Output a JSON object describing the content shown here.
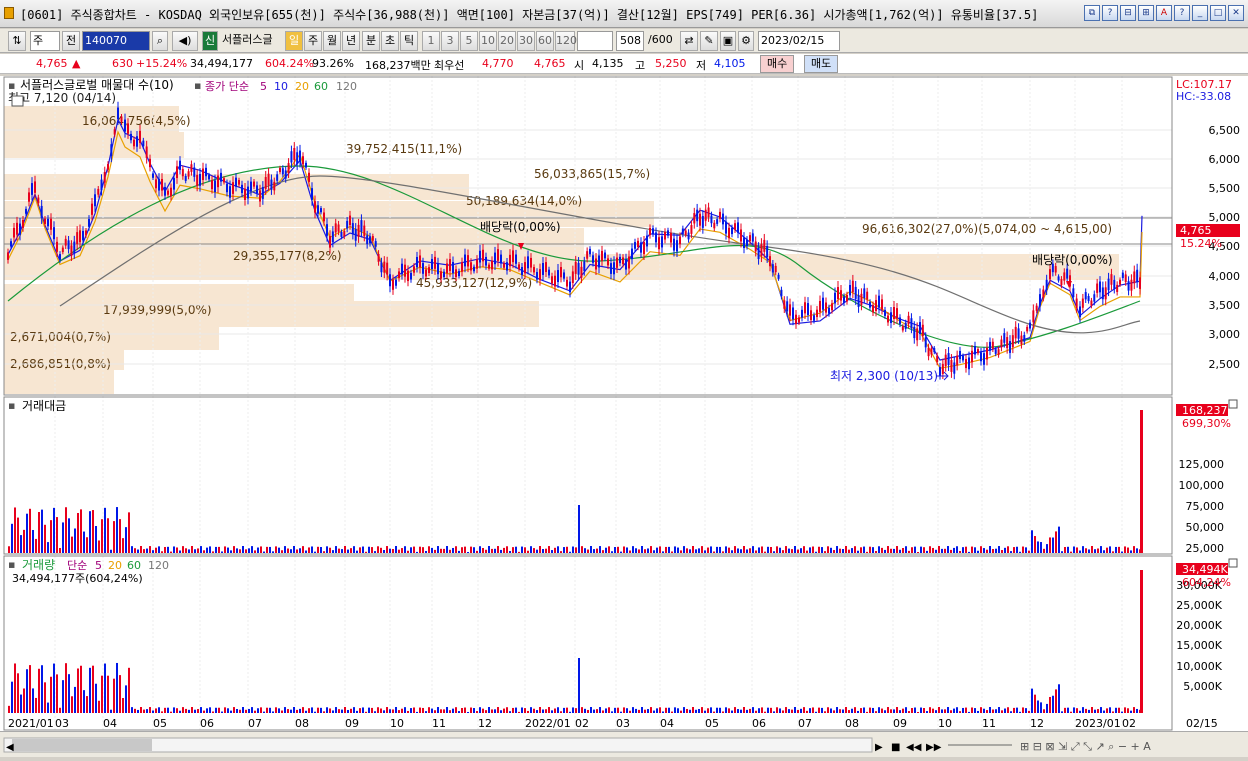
{
  "window": {
    "title": "[0601] 주식종합차트 - KOSDAQ 외국인보유[655(천)] 주식수[36,988(천)] 액면[100] 자본금[37(억)] 결산[12월] EPS[749] PER[6.36] 시가총액[1,762(억)] 유통비율[37.5]",
    "buttons": [
      "⧉",
      "?",
      "⊟",
      "⊞",
      "A",
      "?",
      "_",
      "□",
      "✕"
    ]
  },
  "toolbar": {
    "market": "주",
    "prev_label": "전",
    "code": "140070",
    "stock_name": "서플러스글",
    "tabs": [
      "일",
      "주",
      "월",
      "년",
      "분",
      "초",
      "틱"
    ],
    "numbers": [
      "1",
      "3",
      "5",
      "10",
      "20",
      "30",
      "60",
      "120"
    ],
    "count": "508",
    "total": "/600",
    "date": "2023/02/15"
  },
  "quote": {
    "price": "4,765",
    "arrow": "▲",
    "change": "630",
    "change_pct": "+15.24%",
    "volume": "34,494,177",
    "volume_pct": "604.24%",
    "vol_ratio": "93.26%",
    "amount": "168,237백만",
    "best_label": "최우선",
    "best_ask": "4,770",
    "best_bid": "4,765",
    "open_label": "시",
    "open": "4,135",
    "high_label": "고",
    "high": "5,250",
    "low_label": "저",
    "low": "4,105",
    "buy": "매수",
    "sell": "매도"
  },
  "price_panel": {
    "legend_name": "서플러스글로벌 매물대 수(10)",
    "ma_label": "종가 단순",
    "ma_periods": [
      "5",
      "10",
      "20",
      "60",
      "120"
    ],
    "max_label": "최고 7,120 (04/14)",
    "min_label": "최저 2,300 (10/13)",
    "dividend": "배당락(0,00%)",
    "lc": "LC:107.17",
    "hc": "HC:-33.08",
    "price_tag": "4,765",
    "pct_tag": "15.24%",
    "y_ticks": [
      "6,500",
      "6,000",
      "5,500",
      "5,000",
      "4,500",
      "4,000",
      "3,500",
      "3,000",
      "2,500"
    ],
    "profile": [
      "16,064,756(4,5%)",
      "39,752,415(11,1%)",
      "56,033,865(15,7%)",
      "50,189,634(14,0%)",
      "96,616,302(27,0%)(5,074,00 ~ 4,615,00)",
      "29,355,177(8,2%)",
      "45,933,127(12,9%)",
      "17,939,999(5,0%)",
      "2,671,004(0,7%)",
      "2,686,851(0,8%)"
    ]
  },
  "amount_panel": {
    "title": "거래대금",
    "tag": "168,237",
    "tag_pct": "699,30%",
    "y_ticks": [
      "125,000",
      "100,000",
      "75,000",
      "50,000",
      "25,000"
    ]
  },
  "volume_panel": {
    "title": "거래량",
    "ma_label": "단순",
    "ma_periods": [
      "5",
      "20",
      "60",
      "120"
    ],
    "value_label": "34,494,177주(604,24%)",
    "tag": "34,494K",
    "tag_pct": "604,24%",
    "y_ticks": [
      "30,000K",
      "25,000K",
      "20,000K",
      "15,000K",
      "10,000K",
      "5,000K"
    ]
  },
  "x_axis": [
    "2021/01",
    "03",
    "04",
    "05",
    "06",
    "07",
    "08",
    "09",
    "10",
    "11",
    "12",
    "2022/01",
    "02",
    "03",
    "04",
    "05",
    "06",
    "07",
    "08",
    "09",
    "10",
    "11",
    "12",
    "2023/01",
    "02",
    "02/15"
  ],
  "colors": {
    "up": "#e8001c",
    "down": "#0018e8",
    "ma5": "#1a1ae0",
    "ma20": "#e8a000",
    "ma60": "#1a9a3a",
    "ma120": "#707070",
    "profile": "#f7e6d2"
  }
}
